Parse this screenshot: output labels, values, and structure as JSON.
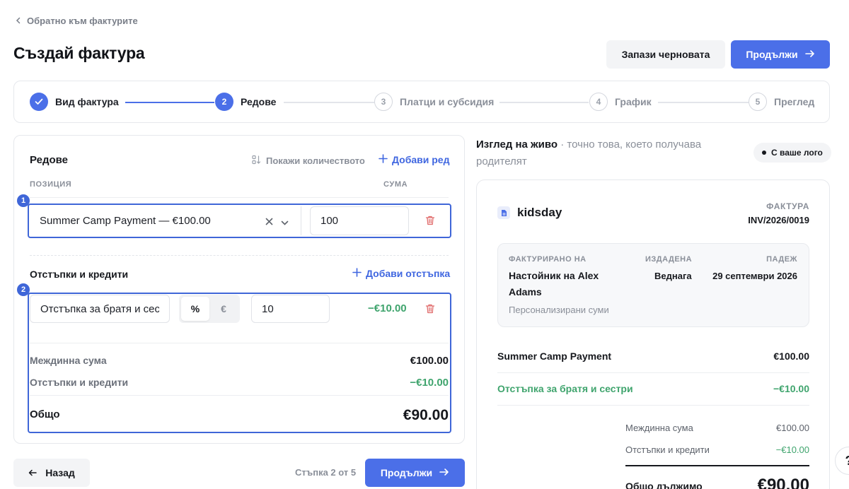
{
  "header": {
    "back_link": "Обратно към фактурите",
    "title": "Създай фактура",
    "save_draft": "Запази черновата",
    "continue": "Продължи"
  },
  "stepper": {
    "steps": [
      {
        "number": "1",
        "label": "Вид фактура",
        "state": "done"
      },
      {
        "number": "2",
        "label": "Редове",
        "state": "active"
      },
      {
        "number": "3",
        "label": "Платци и субсидия",
        "state": "pending"
      },
      {
        "number": "4",
        "label": "График",
        "state": "pending"
      },
      {
        "number": "5",
        "label": "Преглед",
        "state": "pending"
      }
    ]
  },
  "lines": {
    "title": "Редове",
    "show_quantity": "Покажи количеството",
    "add_line": "Добави ред",
    "col_position": "ПОЗИЦИЯ",
    "col_amount": "СУМА",
    "marker_1": "1",
    "item_select_value": "Summer Camp Payment — €100.00",
    "item_amount": "100"
  },
  "discounts": {
    "title": "Отстъпки и кредити",
    "add_discount": "Добави отстъпка",
    "marker_2": "2",
    "name_value": "Отстъпка за братя и сес",
    "type_percent": "%",
    "type_euro": "€",
    "selected_type": "%",
    "value": "10",
    "computed": "−€10.00"
  },
  "summary": {
    "subtotal_label": "Междинна сума",
    "subtotal_value": "€100.00",
    "discounts_label": "Отстъпки и кредити",
    "discounts_value": "−€10.00",
    "total_label": "Общо",
    "total_value": "€90.00"
  },
  "footer": {
    "back": "Назад",
    "step_counter": "Стъпка 2 от 5",
    "continue": "Продължи"
  },
  "preview": {
    "heading_bold": "Изглед на живо",
    "heading_rest": " · точно това, което получава родителят",
    "logo_badge": "С ваше лого",
    "brand": "kidsday",
    "invoice_kind": "ФАКТУРА",
    "invoice_number": "INV/2026/0019",
    "billed_to_label": "ФАКТУРИРАНО НА",
    "billed_to_value": "Настойник на Alex Adams",
    "billed_to_sub": "Персонализирани суми",
    "issued_label": "ИЗДАДЕНА",
    "issued_value": "Веднага",
    "due_label": "ПАДЕЖ",
    "due_value": "29 септември 2026",
    "line_name": "Summer Camp Payment",
    "line_amount": "€100.00",
    "discount_name": "Отстъпка за братя и сестри",
    "discount_amount": "−€10.00",
    "subtotal_label": "Междинна сума",
    "subtotal_value": "€100.00",
    "discounts_label": "Отстъпки и кредити",
    "discounts_value": "−€10.00",
    "total_label": "Общо дължимо",
    "total_value": "€90.00"
  },
  "help": "?",
  "colors": {
    "accent": "#4b6fe8",
    "positive": "#3fa46d",
    "danger": "#e06a6a"
  }
}
